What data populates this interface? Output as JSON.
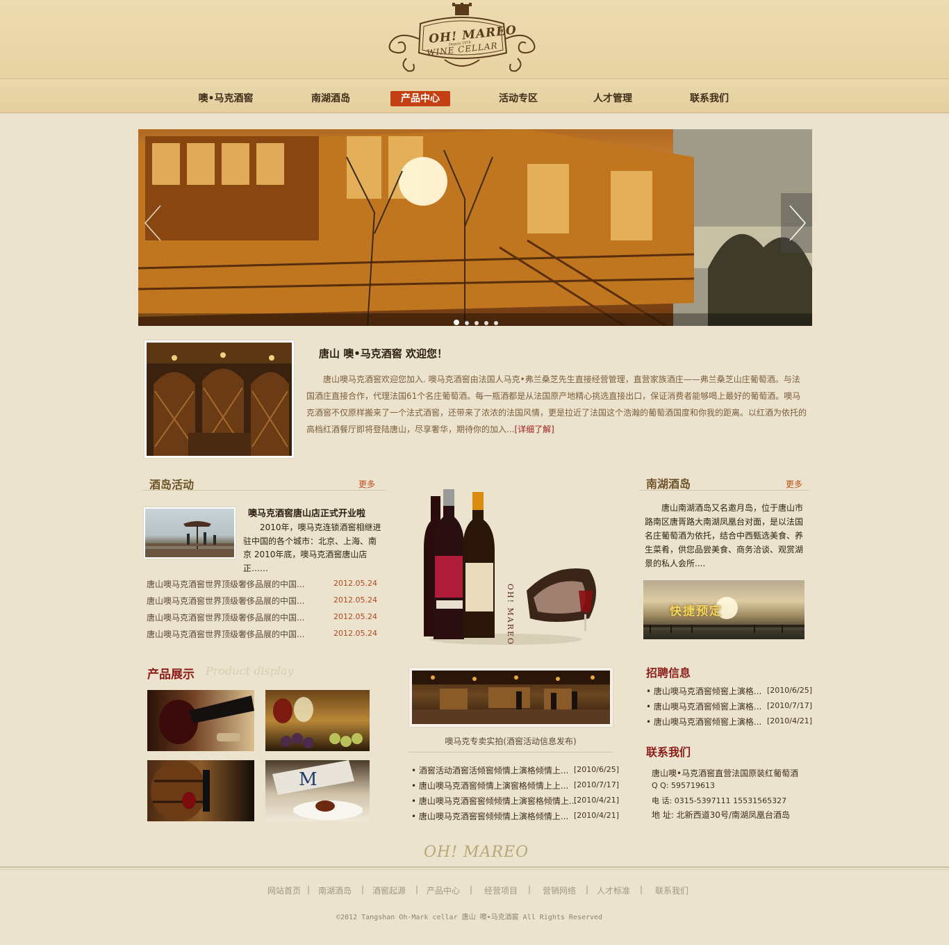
{
  "logo": {
    "line1": "OH! MAREO",
    "line2": "Depuis 1978",
    "line3": "WINE CELLAR"
  },
  "nav": [
    "噢•马克酒窖",
    "南湖酒岛",
    "产品中心",
    "活动专区",
    "人才管理",
    "联系我们"
  ],
  "welcome": {
    "title": "唐山 噢•马克酒窖 欢迎您！",
    "text": "唐山噢马克酒窖欢迎您加入. 噢马克酒窖由法国人马克•弗兰桑芝先生直接经营管理，直营家族酒庄——弗兰桑芝山庄葡萄酒。与法国酒庄直接合作，代理法国61个名庄葡萄酒。每一瓶酒都是从法国原产地精心挑选直接出口，保证消费者能够喝上最好的葡萄酒。噢马克酒窖不仅原样搬来了一个法式酒窖，还带来了浓浓的法国风情，更是拉近了法国这个浩瀚的葡萄酒国度和你我的距离。以红酒为依托的高档红酒餐厅即将登陆唐山，尽享奢华，期待你的加入...",
    "more": "[详细了解]"
  },
  "activity": {
    "title": "酒岛活动",
    "more": "更多",
    "headline": "噢马克酒窖唐山店正式开业啦",
    "summary": "2010年，噢马克连锁酒窖相继进驻中国的各个城市：北京、上海、南京 2010年底，噢马克酒窖唐山店正……",
    "items": [
      {
        "text": "唐山噢马克酒窖世界顶级奢侈品展的中国...",
        "date": "2012.05.24"
      },
      {
        "text": "唐山噢马克酒窖世界顶级奢侈品展的中国...",
        "date": "2012.05.24"
      },
      {
        "text": "唐山噢马克酒窖世界顶级奢侈品展的中国...",
        "date": "2012.05.24"
      },
      {
        "text": "唐山噢马克酒窖世界顶级奢侈品展的中国...",
        "date": "2012.05.24"
      }
    ]
  },
  "products": {
    "title": "产品展示",
    "subtitle": "Product display"
  },
  "center": {
    "brand_vertical": "OH! MAREO",
    "caption": "噢马克专卖实拍(酒窖活动信息发布)",
    "items": [
      {
        "text": "酒窖活动酒窖活倾窖倾情上演格倾情上...",
        "date": "[2010/6/25]"
      },
      {
        "text": "唐山噢马克酒窖倾情上演窖格倾情上上...",
        "date": "[2010/7/17]"
      },
      {
        "text": "唐山噢马克酒窖窖倾倾情上演窖格倾情上...",
        "date": "[2010/4/21]"
      },
      {
        "text": "唐山噢马克酒窖窖倾倾情上演格倾情上...",
        "date": "[2010/4/21]"
      }
    ]
  },
  "nanhu": {
    "title": "南湖酒岛",
    "more": "更多",
    "text": "唐山南湖酒岛又名邀月岛，位于唐山市路南区唐胥路大南湖凤凰台对面，是以法国名庄葡萄酒为依托，结合中西甄选美食、养生菜肴，供您品尝美食、商务洽谈、观赏湖景的私人会所....",
    "booking": "快捷预定"
  },
  "jobs": {
    "title": "招聘信息",
    "items": [
      {
        "text": "唐山噢马克酒窖倾窖上演格...",
        "date": "[2010/6/25]"
      },
      {
        "text": "唐山噢马克酒窖倾窖上演格...",
        "date": "[2010/7/17]"
      },
      {
        "text": "唐山噢马克酒窖倾窖上演格...",
        "date": "[2010/4/21]"
      }
    ]
  },
  "contact": {
    "title": "联系我们",
    "line1": "唐山噢•马克酒窖直营法国原装红葡萄酒",
    "qq": "Q  Q:  595719613",
    "phone": "电 话:  0315-5397111   15531565327",
    "address": "地 址:  北新西道30号/南湖凤凰台酒岛"
  },
  "footer": {
    "logo": "OH! MAREO",
    "links": [
      "网站首页",
      "南湖酒岛",
      "酒窖起源",
      "产品中心",
      "经营项目",
      "营销网络",
      "人才标准",
      "联系我们"
    ],
    "copyright": "©2012 Tangshan Oh·Mark cellar      唐山 噢•马克酒窖 All Rights Reserved"
  },
  "colors": {
    "accent": "#c43f12",
    "heading": "#6e5428",
    "date": "#b0481f",
    "background": "#ece3ce"
  }
}
